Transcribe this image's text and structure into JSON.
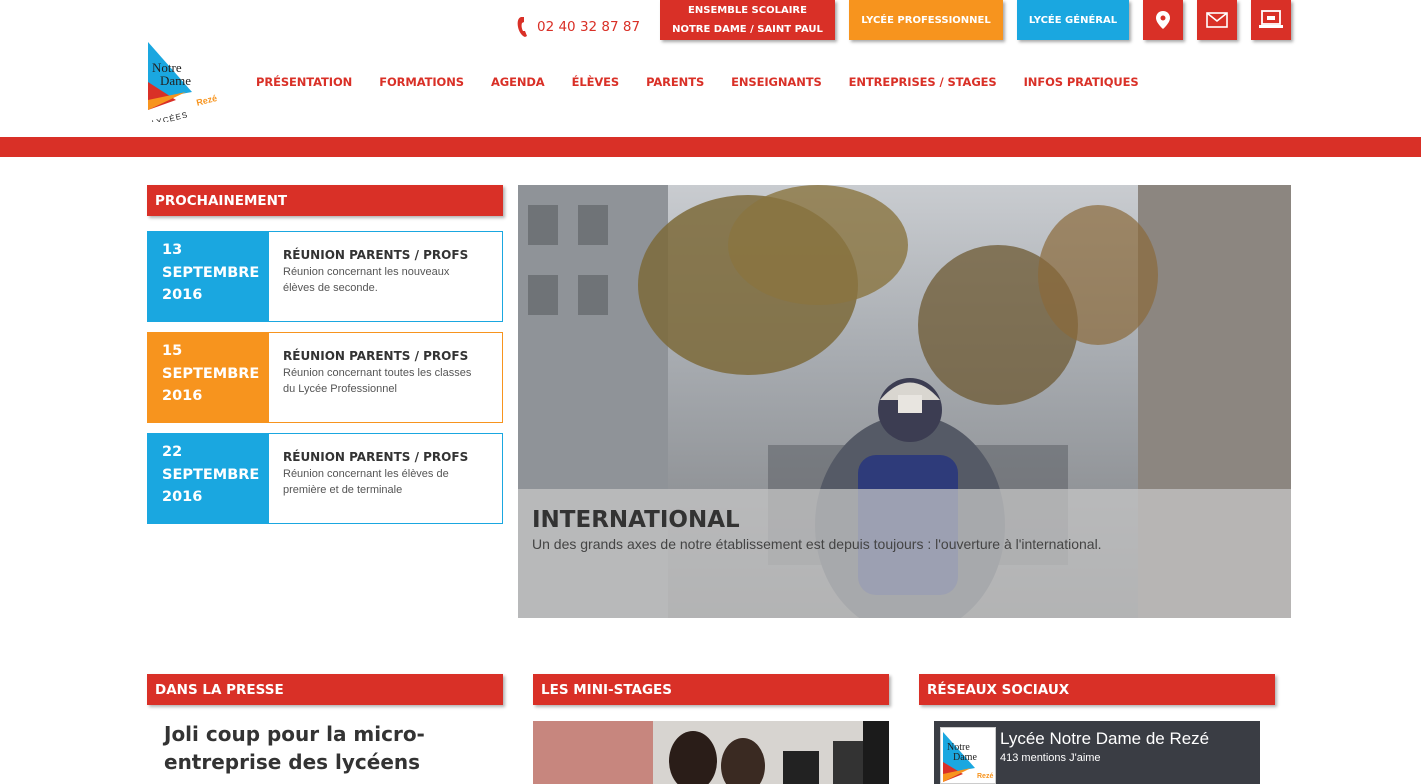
{
  "header": {
    "logo": {
      "line1": "Notre",
      "line2": "Dame",
      "line3": "LYCÉES",
      "line4": "Rezé"
    },
    "phone": "02 40 32 87 87",
    "buttons": {
      "ensemble_line1": "ENSEMBLE SCOLAIRE",
      "ensemble_line2": "NOTRE DAME / SAINT PAUL",
      "pro": "LYCÉE PROFESSIONNEL",
      "general": "LYCÉE GÉNÉRAL"
    },
    "icons": [
      "map-pin-icon",
      "mail-icon",
      "laptop-icon"
    ]
  },
  "nav": [
    "PRÉSENTATION",
    "FORMATIONS",
    "AGENDA",
    "ÉLÈVES",
    "PARENTS",
    "ENSEIGNANTS",
    "ENTREPRISES / STAGES",
    "INFOS PRATIQUES"
  ],
  "prochainement": {
    "heading": "PROCHAINEMENT",
    "events": [
      {
        "day": "13",
        "month": "SEPTEMBRE",
        "year": "2016",
        "title": "RÉUNION PARENTS / PROFS",
        "desc": "Réunion concernant les nouveaux élèves de seconde.",
        "color": "#1aa7e0"
      },
      {
        "day": "15",
        "month": "SEPTEMBRE",
        "year": "2016",
        "title": "RÉUNION PARENTS / PROFS",
        "desc": "Réunion concernant toutes les classes du Lycée Professionnel",
        "color": "#f7941e"
      },
      {
        "day": "22",
        "month": "SEPTEMBRE",
        "year": "2016",
        "title": "RÉUNION PARENTS / PROFS",
        "desc": "Réunion concernant les élèves de première et de terminale",
        "color": "#1aa7e0"
      }
    ]
  },
  "hero": {
    "title": "INTERNATIONAL",
    "text": "Un des grands axes de notre établissement est depuis toujours : l'ouverture à l'international."
  },
  "sections": {
    "presse": {
      "heading": "DANS LA PRESSE",
      "article_title": "Joli coup pour la micro-entreprise des lycéens"
    },
    "ministages": {
      "heading": "LES MINI-STAGES"
    },
    "reseaux": {
      "heading": "RÉSEAUX SOCIAUX",
      "fb_name": "Lycée Notre Dame de Rezé",
      "fb_likes": "413 mentions J'aime"
    }
  },
  "colors": {
    "red": "#d93027",
    "orange": "#f7941e",
    "blue": "#1aa7e0"
  }
}
